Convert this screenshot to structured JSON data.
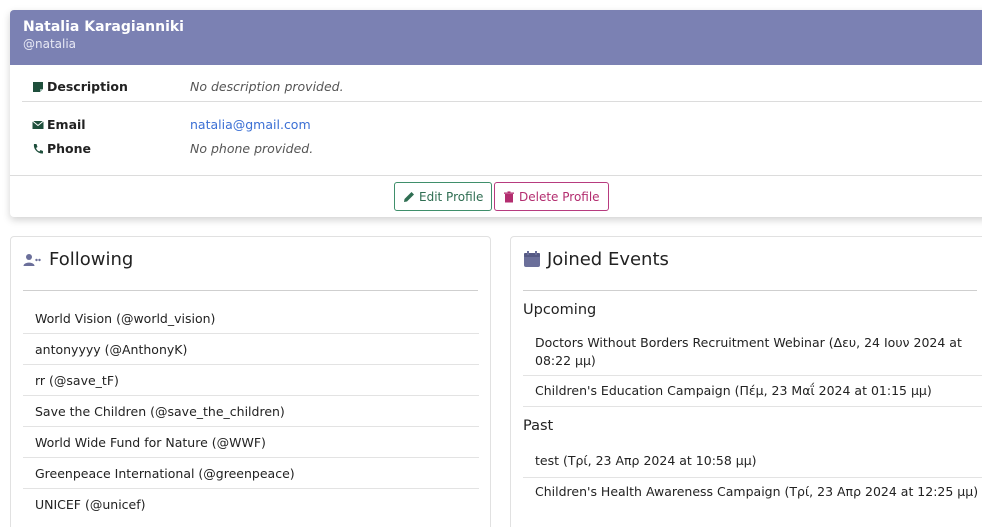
{
  "profile": {
    "name": "Natalia Karagianniki",
    "handle": "@natalia",
    "description_label": "Description",
    "description_value": "No description provided.",
    "email_label": "Email",
    "email_value": "natalia@gmail.com",
    "phone_label": "Phone",
    "phone_value": "No phone provided.",
    "edit_button": "Edit Profile",
    "delete_button": "Delete Profile"
  },
  "following": {
    "title": "Following",
    "items": [
      "World Vision (@world_vision)",
      "antonyyyy (@AnthonyK)",
      "rr (@save_tF)",
      "Save the Children (@save_the_children)",
      "World Wide Fund for Nature (@WWF)",
      "Greenpeace International (@greenpeace)",
      "UNICEF (@unicef)"
    ]
  },
  "events": {
    "title": "Joined Events",
    "upcoming_label": "Upcoming",
    "upcoming": [
      "Doctors Without Borders Recruitment Webinar (Δευ, 24 Ιουν 2024 at 08:22 μμ)",
      "Children's Education Campaign (Πέμ, 23 Μαΐ 2024 at 01:15 μμ)"
    ],
    "past_label": "Past",
    "past": [
      "test (Τρί, 23 Απρ 2024 at 10:58 μμ)",
      "Children's Health Awareness Campaign (Τρί, 23 Απρ 2024 at 12:25 μμ)"
    ]
  },
  "colors": {
    "header": "#7b81b3",
    "edit": "#2f6e52",
    "delete": "#b32d6f",
    "link": "#3b6fd4"
  }
}
